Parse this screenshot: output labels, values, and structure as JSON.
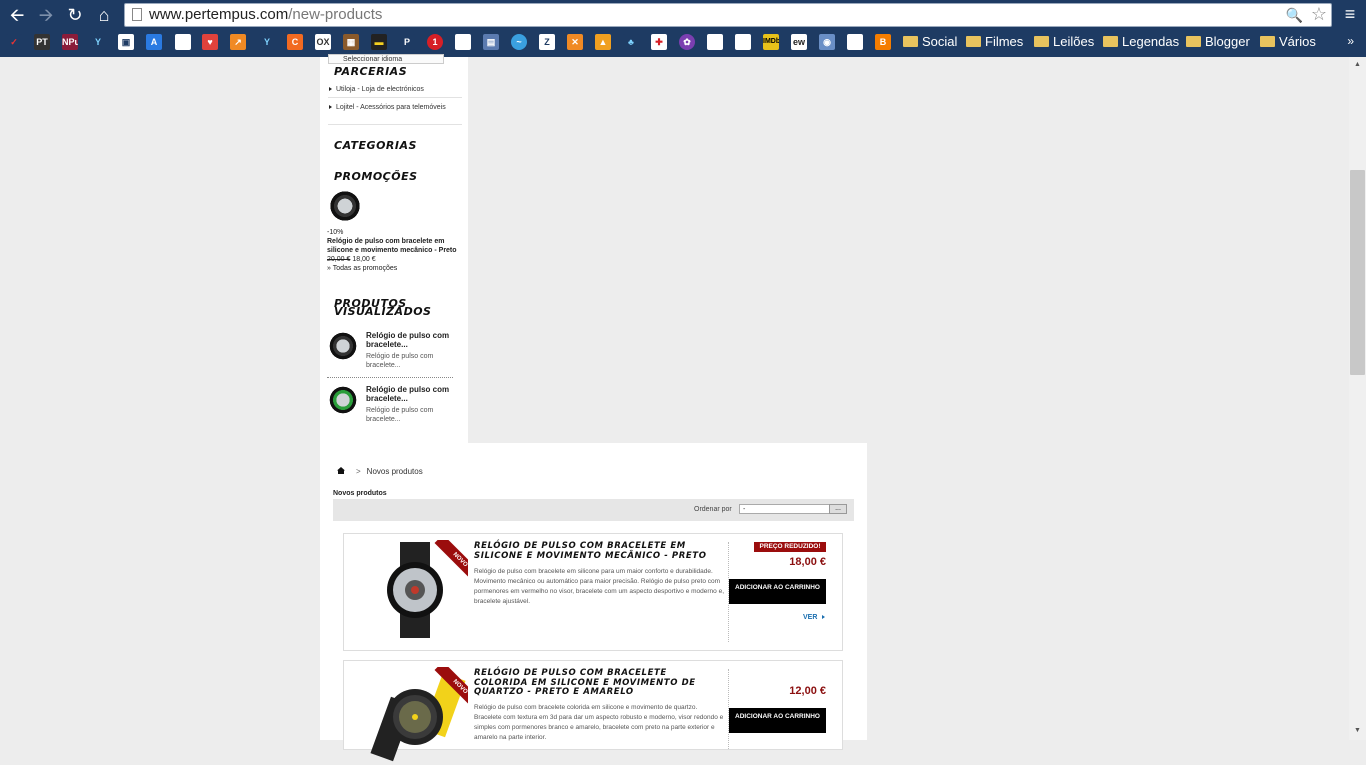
{
  "browser": {
    "url_domain": "www.pertempus.com",
    "url_path": "/new-products",
    "bookmark_folders": [
      "Social",
      "Filmes",
      "Leilões",
      "Legendas",
      "Blogger",
      "Vários"
    ],
    "bookmark_icon_labels": [
      "PT",
      "NPu",
      "IMDb",
      "ew"
    ],
    "more_label": "»"
  },
  "sidebar": {
    "language_select": "Seleccionar idioma",
    "partners_title": "PARCERIAS",
    "partners": [
      "Utiloja - Loja de electrónicos",
      "Lojitel - Acessórios para telemóveis"
    ],
    "categories_title": "CATEGORIAS",
    "promotions_title": "PROMOÇÕES",
    "promo": {
      "discount": "-10%",
      "name": "Relógio de pulso com bracelete em silicone e movimento mecânico - Preto",
      "old_price": "20,00 €",
      "new_price": "18,00 €",
      "all_link": "» Todas as promoções"
    },
    "viewed_title": "PRODUTOS VISUALIZADOS",
    "viewed": [
      {
        "name": "Relógio de pulso com bracelete...",
        "desc": "Relógio de pulso com bracelete..."
      },
      {
        "name": "Relógio de pulso com bracelete...",
        "desc": "Relógio de pulso com bracelete..."
      }
    ]
  },
  "content": {
    "breadcrumb_sep": ">",
    "breadcrumb_current": "Novos produtos",
    "heading": "Novos produtos",
    "sort_label": "Ordenar por",
    "sort_value": "-",
    "sort_button": "...",
    "products": [
      {
        "badge": "NOVO",
        "name": "Relógio de pulso com bracelete em silicone e movimento mecânico - Preto",
        "description": "Relógio de pulso com bracelete em silicone para um maior conforto e durabilidade. Movimento mecânico ou automático para maior precisão. Relógio de pulso preto com pormenores em vermelho no visor, bracelete com um aspecto desportivo e moderno e, bracelete ajustável.",
        "reduced_label": "PREÇO REDUZIDO!",
        "price": "18,00 €",
        "cart_label": "ADICIONAR AO CARRINHO",
        "view_label": "VER"
      },
      {
        "badge": "NOVO",
        "name": "Relógio de pulso com bracelete colorida em silicone e movimento de quartzo - Preto e Amarelo",
        "description": "Relógio de pulso com bracelete colorida em silicone e movimento de quartzo. Bracelete com textura em 3d para dar um aspecto robusto e moderno, visor redondo e simples com pormenores branco e amarelo, bracelete com preto na parte exterior e amarelo na parte interior.",
        "price": "12,00 €",
        "cart_label": "ADICIONAR AO CARRINHO"
      }
    ]
  }
}
